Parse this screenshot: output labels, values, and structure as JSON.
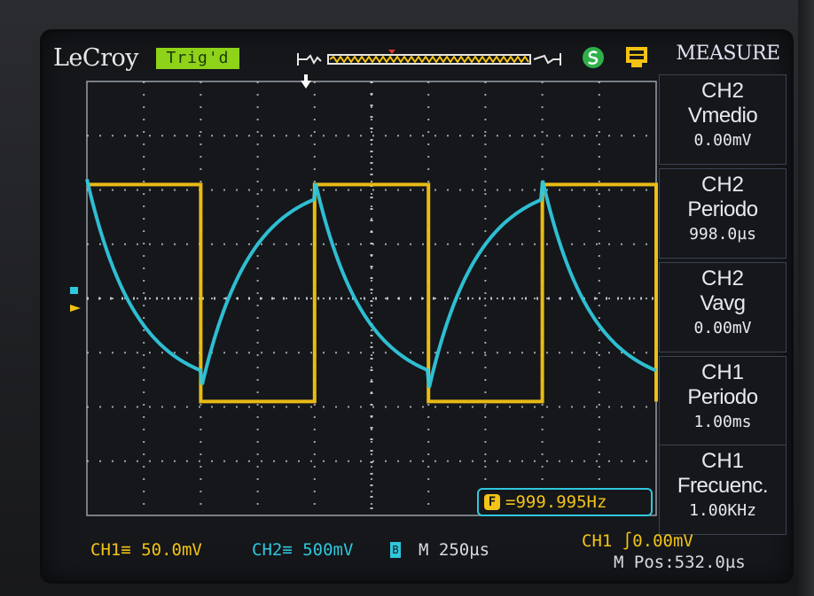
{
  "top": {
    "brand": "LeCroy",
    "trigger_status": "Trig'd",
    "measure_title": "MEASURE"
  },
  "icons": [
    "lecroy-logo",
    "run-state-icon",
    "usb-icon",
    "trigger-point-icon",
    "ground-marker-icon"
  ],
  "colors": {
    "ch1": "#f3c315",
    "ch2": "#2fc7dc",
    "grid": "#cfd3da",
    "screen_bg": "#15171b",
    "trig_status_bg": "#8ed21a"
  },
  "measurements": [
    {
      "channel": "CH2",
      "name": "Vmedio",
      "value": "0.00mV"
    },
    {
      "channel": "CH2",
      "name": "Periodo",
      "value": "998.0µs"
    },
    {
      "channel": "CH2",
      "name": "Vavg",
      "value": "0.00mV"
    },
    {
      "channel": "CH1",
      "name": "Periodo",
      "value": "1.00ms"
    },
    {
      "channel": "CH1",
      "name": "Frecuenc.",
      "value": "1.00KHz"
    }
  ],
  "frequency_counter": "=999.995Hz",
  "status": {
    "ch1_scale": "CH1≡ 50.0mV",
    "ch2_scale": "CH2≡ 500mV",
    "ch2_bw_limit": "B",
    "timebase": "M 250µs",
    "trigger": "CH1 ∫0.00mV",
    "horizontal_position": "M Pos:532.0µs"
  },
  "waveforms": {
    "ch1": {
      "shape": "square",
      "period_divisions": 4,
      "high_divisions": 2.1,
      "low_divisions": -1.9
    },
    "ch2": {
      "shape": "rc-charge-discharge",
      "period_divisions": 4,
      "high_divisions": 2.2,
      "low_divisions": -1.7
    }
  }
}
